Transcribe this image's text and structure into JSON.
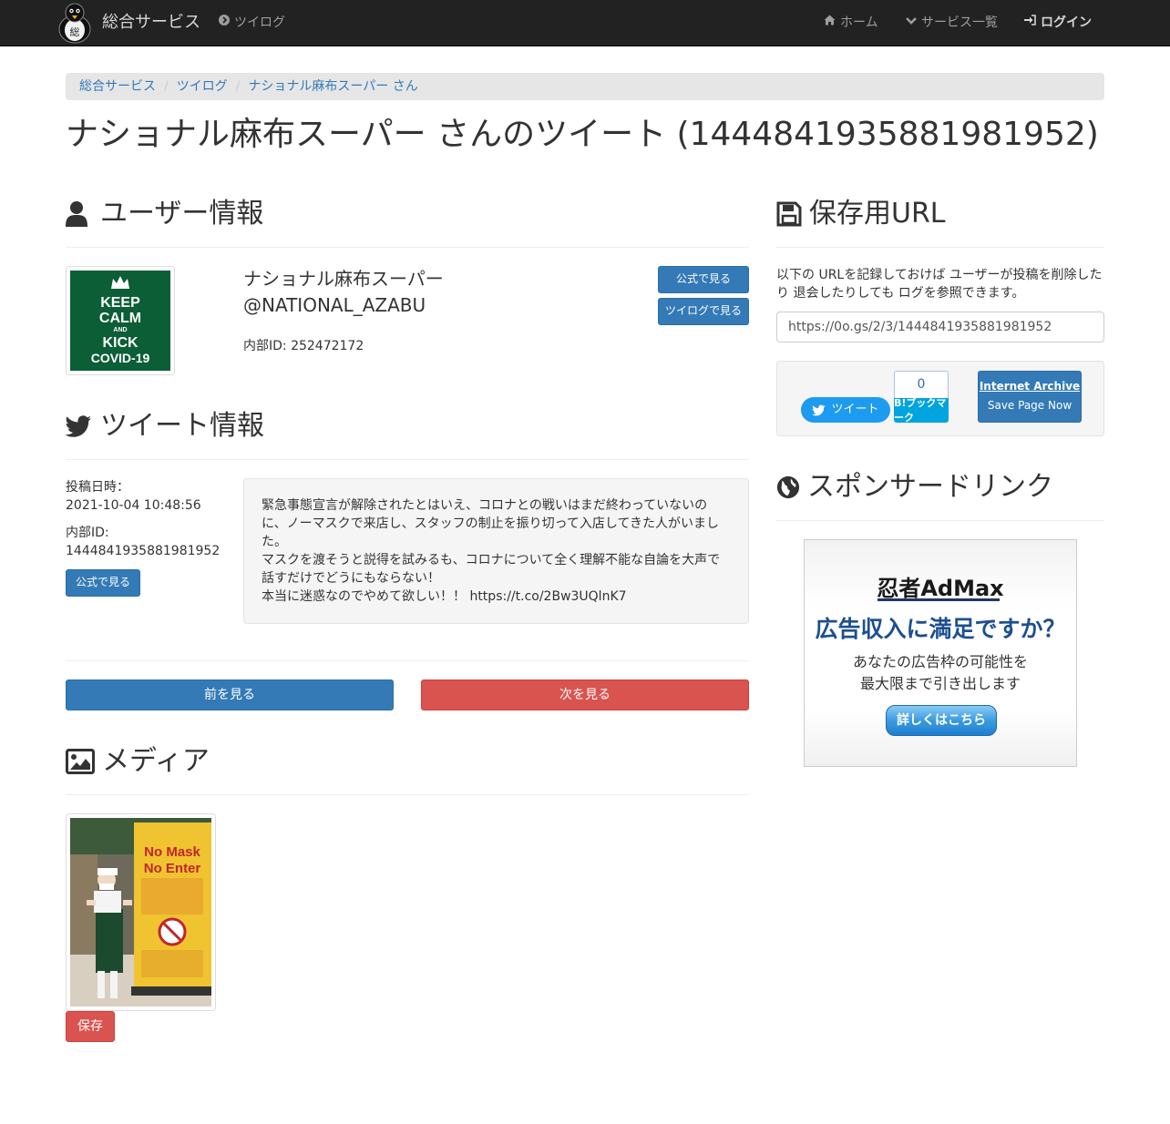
{
  "navbar": {
    "brand": "総合サービス",
    "tsuilog": "ツイログ",
    "home": "ホーム",
    "services": "サービス一覧",
    "login": "ログイン"
  },
  "breadcrumb": {
    "items": [
      "総合サービス",
      "ツイログ",
      "ナショナル麻布スーパー さん"
    ]
  },
  "page_title": "ナショナル麻布スーパー さんのツイート (1444841935881981952)",
  "user_section": {
    "heading": "ユーザー情報",
    "avatar_lines": [
      "KEEP",
      "CALM",
      "AND",
      "KICK",
      "COVID-19"
    ],
    "display_name": "ナショナル麻布スーパー",
    "handle": "@NATIONAL_AZABU",
    "internal_id": "内部ID: 252472172",
    "btn_official": "公式で見る",
    "btn_tsuilog": "ツイログで見る"
  },
  "tweet_section": {
    "heading": "ツイート情報",
    "posted_label": "投稿日時：",
    "posted_value": "2021-10-04 10:48:56",
    "id_label": "内部ID:",
    "id_value": "1444841935881981952",
    "btn_official": "公式で見る",
    "text_lines": [
      "緊急事態宣言が解除されたとはいえ、コロナとの戦いはまだ終わっていないの",
      "に、ノーマスクで来店し、スタッフの制止を振り切って入店してきた人がいまし",
      "た。",
      "マスクを渡そうと説得を試みるも、コロナについて全く理解不能な自論を大声で",
      "話すだけでどうにもならない！",
      "本当に迷惑なのでやめて欲しい！！ https://t.co/2Bw3UQlnK7"
    ]
  },
  "pager": {
    "prev": "前を見る",
    "next": "次を見る"
  },
  "media_section": {
    "heading": "メディア",
    "sign_title_1": "No Mask",
    "sign_title_2": "No Enter",
    "save": "保存"
  },
  "save_section": {
    "heading": "保存用URL",
    "description": "以下の URLを記録しておけば ユーザーが投稿を削除したり 退会したりしても ログを参照できます。",
    "url": "https://0o.gs/2/3/1444841935881981952",
    "tweet_btn": "ツイート",
    "hatena_count": "0",
    "hatena_label": "B!ブックマーク",
    "ia_line1": "Internet Archive",
    "ia_line2": "Save Page Now"
  },
  "sponsor_section": {
    "heading": "スポンサードリンク",
    "ad_logo": "忍者AdMax",
    "ad_headline": "広告収入に満足ですか？",
    "ad_sub_1": "あなたの広告枠の可能性を",
    "ad_sub_2": "最大限まで引き出します",
    "ad_button": "詳しくはこちら"
  },
  "colors": {
    "navbar_bg": "#222222",
    "primary": "#337ab7",
    "danger": "#d9534f",
    "avatar_green": "#0b5e36"
  }
}
